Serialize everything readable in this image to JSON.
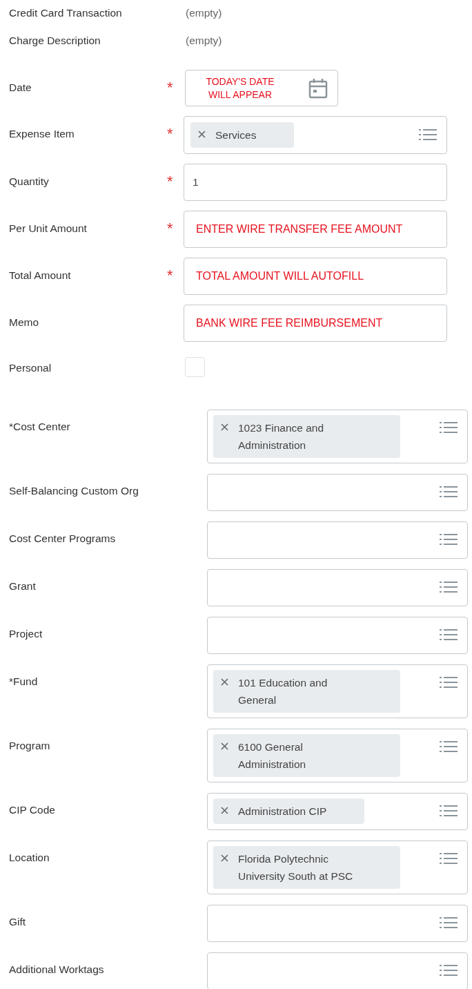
{
  "upper_fields": [
    {
      "label": "Credit Card Transaction",
      "kind": "readonly",
      "value": "(empty)"
    },
    {
      "label": "Charge Description",
      "kind": "readonly",
      "value": "(empty)"
    },
    {
      "label": "Date",
      "kind": "date",
      "required_mark": "*",
      "value": "TODAY'S DATE WILL APPEAR",
      "note": true
    },
    {
      "label": "Expense Item",
      "kind": "prompt",
      "required_mark": "*",
      "items": [
        "Services"
      ]
    },
    {
      "label": "Quantity",
      "kind": "input",
      "required_mark": "*",
      "value": "1",
      "note": false
    },
    {
      "label": "Per Unit Amount",
      "kind": "input",
      "required_mark": "*",
      "value": "ENTER WIRE TRANSFER FEE AMOUNT",
      "note": true
    },
    {
      "label": "Total Amount",
      "kind": "input",
      "required_mark": "*",
      "value": "TOTAL AMOUNT WILL AUTOFILL",
      "note": true
    },
    {
      "label": "Memo",
      "kind": "input",
      "value": "BANK WIRE FEE REIMBURSEMENT",
      "note": true
    },
    {
      "label": "Personal",
      "kind": "checkbox",
      "checked": false
    }
  ],
  "worktags": [
    {
      "label": "*Cost Center",
      "items": [
        "1023 Finance and Administration"
      ]
    },
    {
      "label": "Self-Balancing Custom Org"
    },
    {
      "label": "Cost Center Programs"
    },
    {
      "label": "Grant"
    },
    {
      "label": "Project"
    },
    {
      "label": "*Fund",
      "items": [
        "101 Education and General"
      ]
    },
    {
      "label": "Program",
      "items": [
        "6100 General Administration"
      ]
    },
    {
      "label": "CIP Code",
      "items": [
        "Administration CIP"
      ]
    },
    {
      "label": "Location",
      "items": [
        "Florida Polytechnic University South at PSC"
      ]
    },
    {
      "label": "Gift"
    },
    {
      "label": "Additional Worktags"
    }
  ]
}
